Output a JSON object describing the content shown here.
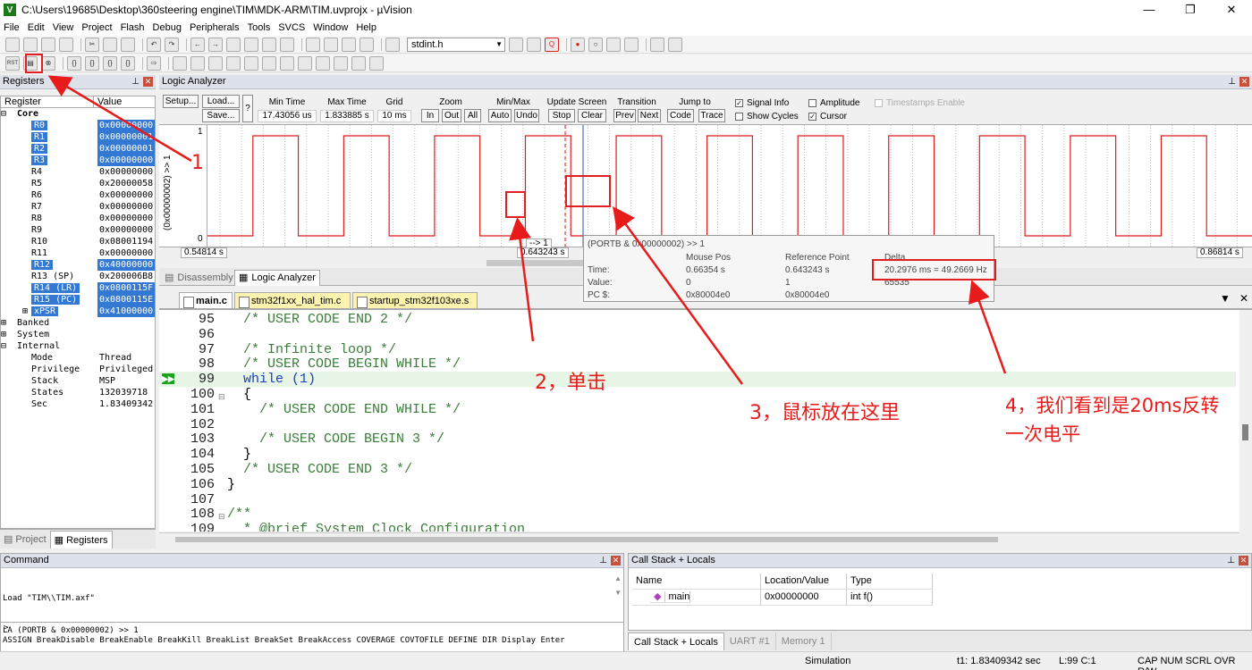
{
  "window": {
    "title": "C:\\Users\\19685\\Desktop\\360steering engine\\TIM\\MDK-ARM\\TIM.uvprojx - µVision",
    "icon": "V",
    "controls": [
      "—",
      "❐",
      "✕"
    ]
  },
  "menu": [
    "File",
    "Edit",
    "View",
    "Project",
    "Flash",
    "Debug",
    "Peripherals",
    "Tools",
    "SVCS",
    "Window",
    "Help"
  ],
  "toolbar": {
    "file_combo": "stdint.h",
    "reset_label": "RST"
  },
  "registers": {
    "title": "Registers",
    "col_register": "Register",
    "col_value": "Value",
    "rows": [
      {
        "name": "Core",
        "value": "",
        "indent": 0,
        "bold": true,
        "sel": false,
        "tree": "⊟"
      },
      {
        "name": "R0",
        "value": "0x00000000",
        "indent": 2,
        "sel": true
      },
      {
        "name": "R1",
        "value": "0x00000001",
        "indent": 2,
        "sel": true
      },
      {
        "name": "R2",
        "value": "0x00000001",
        "indent": 2,
        "sel": true
      },
      {
        "name": "R3",
        "value": "0x00000000",
        "indent": 2,
        "sel": true
      },
      {
        "name": "R4",
        "value": "0x00000000",
        "indent": 2,
        "sel": false
      },
      {
        "name": "R5",
        "value": "0x20000058",
        "indent": 2,
        "sel": false
      },
      {
        "name": "R6",
        "value": "0x00000000",
        "indent": 2,
        "sel": false
      },
      {
        "name": "R7",
        "value": "0x00000000",
        "indent": 2,
        "sel": false
      },
      {
        "name": "R8",
        "value": "0x00000000",
        "indent": 2,
        "sel": false
      },
      {
        "name": "R9",
        "value": "0x00000000",
        "indent": 2,
        "sel": false
      },
      {
        "name": "R10",
        "value": "0x08001194",
        "indent": 2,
        "sel": false
      },
      {
        "name": "R11",
        "value": "0x00000000",
        "indent": 2,
        "sel": false
      },
      {
        "name": "R12",
        "value": "0x40000000",
        "indent": 2,
        "sel": true
      },
      {
        "name": "R13 (SP)",
        "value": "0x200006B8",
        "indent": 2,
        "sel": false
      },
      {
        "name": "R14 (LR)",
        "value": "0x0800115F",
        "indent": 2,
        "sel": true
      },
      {
        "name": "R15 (PC)",
        "value": "0x0800115E",
        "indent": 2,
        "sel": true
      },
      {
        "name": "xPSR",
        "value": "0x41000000",
        "indent": 2,
        "sel": true,
        "tree": "⊞"
      },
      {
        "name": "Banked",
        "value": "",
        "indent": 0,
        "sel": false,
        "tree": "⊞"
      },
      {
        "name": "System",
        "value": "",
        "indent": 0,
        "sel": false,
        "tree": "⊞"
      },
      {
        "name": "Internal",
        "value": "",
        "indent": 0,
        "sel": false,
        "tree": "⊟"
      },
      {
        "name": "Mode",
        "value": "Thread",
        "indent": 2,
        "sel": false
      },
      {
        "name": "Privilege",
        "value": "Privileged",
        "indent": 2,
        "sel": false
      },
      {
        "name": "Stack",
        "value": "MSP",
        "indent": 2,
        "sel": false
      },
      {
        "name": "States",
        "value": "132039718",
        "indent": 2,
        "sel": false
      },
      {
        "name": "Sec",
        "value": "1.83409342",
        "indent": 2,
        "sel": false
      }
    ],
    "tab_project": "Project",
    "tab_registers": "Registers"
  },
  "logic_analyzer": {
    "title": "Logic Analyzer",
    "setup": "Setup...",
    "load": "Load...",
    "save": "Save...",
    "help": "?",
    "min_time_label": "Min Time",
    "min_time": "17.43056 us",
    "max_time_label": "Max Time",
    "max_time": "1.833885 s",
    "grid_label": "Grid",
    "grid": "10 ms",
    "zoom_label": "Zoom",
    "zoom_in": "In",
    "zoom_out": "Out",
    "zoom_all": "All",
    "minmax_label": "Min/Max",
    "auto": "Auto",
    "undo": "Undo",
    "update_label": "Update Screen",
    "stop": "Stop",
    "clear": "Clear",
    "transition_label": "Transition",
    "prev": "Prev",
    "next": "Next",
    "jump_label": "Jump to",
    "code": "Code",
    "trace": "Trace",
    "signal_info": "Signal Info",
    "show_cycles": "Show Cycles",
    "amplitude": "Amplitude",
    "cursor": "Cursor",
    "timestamps": "Timestamps Enable",
    "signal_name": "(0x00000002) >> 1",
    "y_high": "1",
    "y_low": "0",
    "t_left": "0.54814 s",
    "t_cursor": "0.643243 s",
    "t_right": "0.86814 s",
    "cursor_tag": "--> 1",
    "signal_levels": [
      0,
      1,
      0,
      1,
      0,
      1,
      0,
      1,
      0,
      1,
      0,
      1,
      0,
      1,
      0,
      1,
      0,
      1,
      0,
      1,
      0,
      1,
      0
    ]
  },
  "tooltip": {
    "header": "(PORTB & 0x00000002) >> 1",
    "col_mouse": "Mouse Pos",
    "col_ref": "Reference Point",
    "col_delta": "Delta",
    "row_time": "Time:",
    "row_value": "Value:",
    "row_pc": "PC $:",
    "mouse_time": "0.66354 s",
    "ref_time": "0.643243 s",
    "delta_time": "20.2976 ms = 49.2669 Hz",
    "mouse_value": "0",
    "ref_value": "1",
    "delta_value": "65535",
    "mouse_pc": "0x80004e0",
    "ref_pc": "0x80004e0"
  },
  "bottom_tabs": {
    "disassembly": "Disassembly",
    "logic_analyzer": "Logic Analyzer"
  },
  "files": [
    "main.c",
    "stm32f1xx_hal_tim.c",
    "startup_stm32f103xe.s"
  ],
  "editor": {
    "lines": [
      {
        "n": "95",
        "fold": "",
        "segs": [
          {
            "t": "  /* USER CODE END 2 */",
            "c": "cmt"
          }
        ]
      },
      {
        "n": "96",
        "fold": "",
        "segs": []
      },
      {
        "n": "97",
        "fold": "",
        "segs": [
          {
            "t": "  /* Infinite loop */",
            "c": "cmt"
          }
        ]
      },
      {
        "n": "98",
        "fold": "",
        "segs": [
          {
            "t": "  /* USER CODE BEGIN WHILE */",
            "c": "cmt"
          }
        ]
      },
      {
        "n": "99",
        "fold": "",
        "segs": [
          {
            "t": "  ",
            "c": ""
          },
          {
            "t": "while",
            "c": "kw"
          },
          {
            "t": " (1)",
            "c": "kw"
          }
        ],
        "current": true
      },
      {
        "n": "100",
        "fold": "⊟",
        "segs": [
          {
            "t": "  {",
            "c": ""
          }
        ]
      },
      {
        "n": "101",
        "fold": "",
        "segs": [
          {
            "t": "    /* USER CODE END WHILE */",
            "c": "cmt"
          }
        ]
      },
      {
        "n": "102",
        "fold": "",
        "segs": []
      },
      {
        "n": "103",
        "fold": "",
        "segs": [
          {
            "t": "    /* USER CODE BEGIN 3 */",
            "c": "cmt"
          }
        ]
      },
      {
        "n": "104",
        "fold": "",
        "segs": [
          {
            "t": "  }",
            "c": ""
          }
        ]
      },
      {
        "n": "105",
        "fold": "",
        "segs": [
          {
            "t": "  /* USER CODE END 3 */",
            "c": "cmt"
          }
        ]
      },
      {
        "n": "106",
        "fold": "",
        "segs": [
          {
            "t": "}",
            "c": ""
          }
        ]
      },
      {
        "n": "107",
        "fold": "",
        "segs": []
      },
      {
        "n": "108",
        "fold": "⊟",
        "segs": [
          {
            "t": "/**",
            "c": "cmt"
          }
        ]
      },
      {
        "n": "109",
        "fold": "",
        "segs": [
          {
            "t": "  * @brief System Clock Configuration",
            "c": "cmt"
          }
        ]
      }
    ]
  },
  "command": {
    "title": "Command",
    "output": [
      "Load \"TIM\\\\TIM.axf\"",
      "LA (PORTB & 0x00000002) >> 1"
    ],
    "prompt": ">",
    "help": "ASSIGN BreakDisable BreakEnable BreakKill BreakList BreakSet BreakAccess COVERAGE COVTOFILE DEFINE DIR Display Enter"
  },
  "callstack": {
    "title": "Call Stack + Locals",
    "headers": [
      "Name",
      "Location/Value",
      "Type"
    ],
    "rows": [
      {
        "name": "main",
        "loc": "0x00000000",
        "type": "int f()"
      }
    ],
    "tabs": [
      "Call Stack + Locals",
      "UART #1",
      "Memory 1"
    ]
  },
  "status": {
    "mode": "Simulation",
    "time": "t1: 1.83409342 sec",
    "pos": "L:99 C:1",
    "flags": "CAP  NUM  SCRL  OVR  R/W"
  },
  "annotations": {
    "a1": "1",
    "a2": "2，单击",
    "a3": "3，鼠标放在这里",
    "a4": "4，我们看到是20ms反转",
    "a4b": "一次电平"
  },
  "colors": {
    "annotation": "#e81b1b",
    "signal": "#d81e1e",
    "selection": "#3378d2"
  }
}
